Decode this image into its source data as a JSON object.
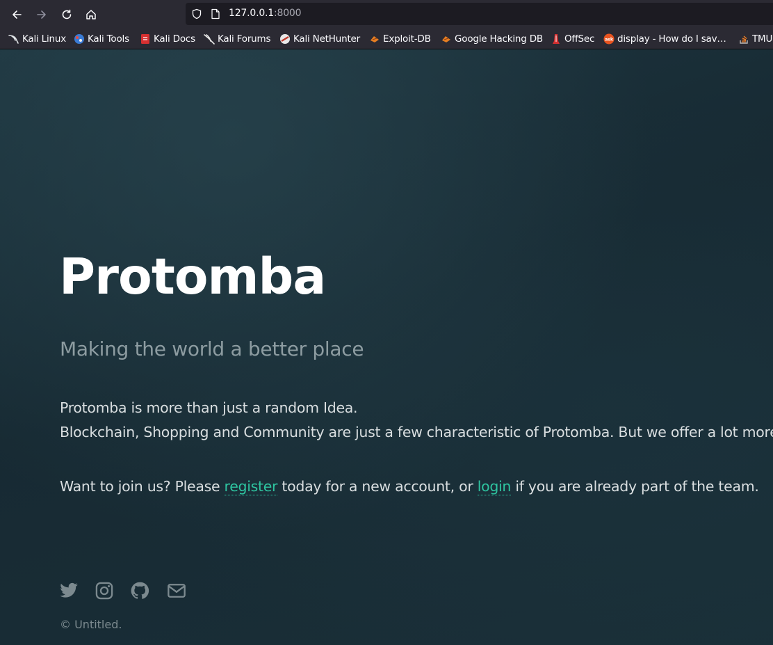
{
  "browser": {
    "url_host": "127.0.0.1",
    "url_port": ":8000",
    "bookmarks": [
      {
        "label": "Kali Linux",
        "icon": "kali-dragon-icon"
      },
      {
        "label": "Kali Tools",
        "icon": "kali-tools-icon"
      },
      {
        "label": "Kali Docs",
        "icon": "kali-docs-icon"
      },
      {
        "label": "Kali Forums",
        "icon": "kali-forums-icon"
      },
      {
        "label": "Kali NetHunter",
        "icon": "nethunter-icon"
      },
      {
        "label": "Exploit-DB",
        "icon": "exploit-db-icon"
      },
      {
        "label": "Google Hacking DB",
        "icon": "ghdb-icon"
      },
      {
        "label": "OffSec",
        "icon": "offsec-icon"
      },
      {
        "label": "display - How do I sav…",
        "icon": "askubuntu-icon"
      },
      {
        "label": "TMU",
        "icon": "stackoverflow-icon"
      }
    ]
  },
  "hero": {
    "title": "Protomba",
    "subtitle": "Making the world a better place",
    "line1": "Protomba is more than just a random Idea.",
    "line2": "Blockchain, Shopping and Community are just a few characteristic of Protomba. But we offer a lot more!",
    "join_prefix": "Want to join us? Please ",
    "register_link": "register",
    "join_middle": " today for a new account, or ",
    "login_link": "login",
    "join_suffix": " if you are already part of the team."
  },
  "footer": {
    "social_icons": [
      "twitter-icon",
      "instagram-icon",
      "github-icon",
      "mail-icon"
    ],
    "copyright": "© Untitled."
  },
  "colors": {
    "accent": "#2ec4a0",
    "background": "#1b2b33",
    "title": "#ffffff",
    "subtitle": "#8d9ca1"
  }
}
